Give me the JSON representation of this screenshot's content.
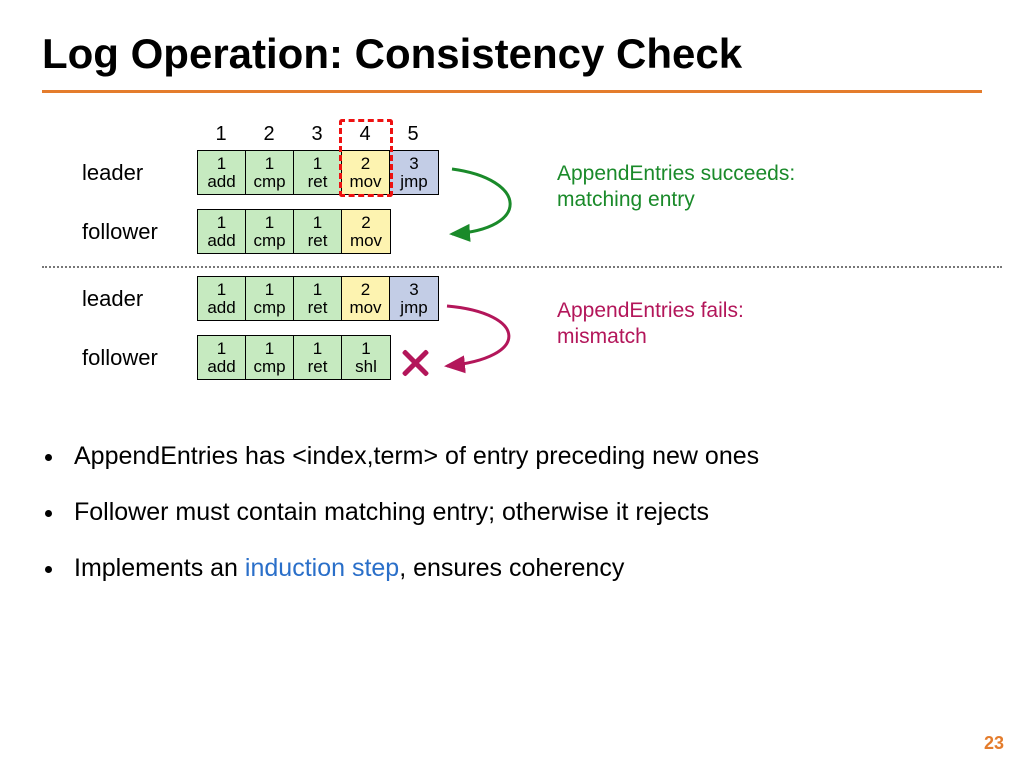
{
  "title": "Log Operation:  Consistency Check",
  "indices": [
    "1",
    "2",
    "3",
    "4",
    "5"
  ],
  "roles": {
    "leader": "leader",
    "follower": "follower"
  },
  "scenario1": {
    "leader_log": [
      {
        "term": "1",
        "cmd": "add",
        "color": "green"
      },
      {
        "term": "1",
        "cmd": "cmp",
        "color": "green"
      },
      {
        "term": "1",
        "cmd": "ret",
        "color": "green"
      },
      {
        "term": "2",
        "cmd": "mov",
        "color": "yellow"
      },
      {
        "term": "3",
        "cmd": "jmp",
        "color": "blue"
      }
    ],
    "follower_log": [
      {
        "term": "1",
        "cmd": "add",
        "color": "green"
      },
      {
        "term": "1",
        "cmd": "cmp",
        "color": "green"
      },
      {
        "term": "1",
        "cmd": "ret",
        "color": "green"
      },
      {
        "term": "2",
        "cmd": "mov",
        "color": "yellow"
      }
    ],
    "annotation": "AppendEntries succeeds: matching entry"
  },
  "scenario2": {
    "leader_log": [
      {
        "term": "1",
        "cmd": "add",
        "color": "green"
      },
      {
        "term": "1",
        "cmd": "cmp",
        "color": "green"
      },
      {
        "term": "1",
        "cmd": "ret",
        "color": "green"
      },
      {
        "term": "2",
        "cmd": "mov",
        "color": "yellow"
      },
      {
        "term": "3",
        "cmd": "jmp",
        "color": "blue"
      }
    ],
    "follower_log": [
      {
        "term": "1",
        "cmd": "add",
        "color": "green"
      },
      {
        "term": "1",
        "cmd": "cmp",
        "color": "green"
      },
      {
        "term": "1",
        "cmd": "ret",
        "color": "green"
      },
      {
        "term": "1",
        "cmd": "shl",
        "color": "green"
      }
    ],
    "annotation": "AppendEntries fails: mismatch"
  },
  "bullets": [
    {
      "pre": "AppendEntries has <index,term> of entry preceding new ones"
    },
    {
      "pre": "Follower must contain matching entry; otherwise it rejects"
    },
    {
      "pre": "Implements an ",
      "link": "induction step",
      "post": ", ensures coherency"
    }
  ],
  "page_number": "23",
  "colors": {
    "accent": "#e47c2c",
    "success": "#1a8a2a",
    "fail": "#b3165a"
  }
}
